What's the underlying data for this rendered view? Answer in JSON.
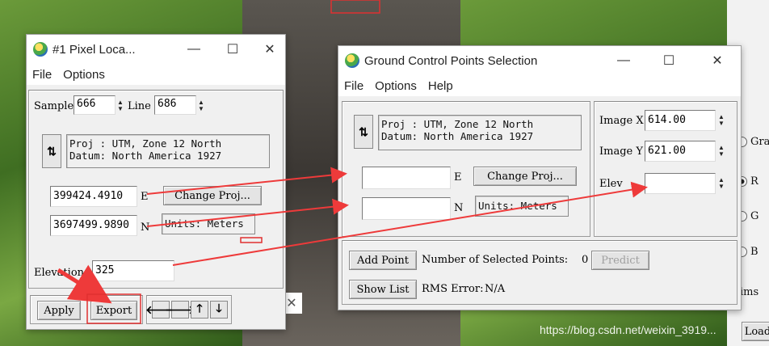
{
  "pixel_locator": {
    "title": "#1 Pixel Loca...",
    "menu": [
      "File",
      "Options"
    ],
    "sample_label": "Sample",
    "sample_value": "666",
    "line_label": "Line",
    "line_value": "686",
    "proj_readout": "Proj : UTM, Zone 12 North\nDatum: North America 1927",
    "easting_value": "399424.4910",
    "easting_label": "E",
    "northing_value": "3697499.9890",
    "northing_label": "N",
    "change_proj_label": "Change Proj...",
    "units_label": "Units: Meters",
    "elevation_label": "Elevation",
    "elevation_value": "325",
    "apply_label": "Apply",
    "export_label": "Export"
  },
  "gcp_window": {
    "title": "Ground Control Points Selection",
    "menu": [
      "File",
      "Options",
      "Help"
    ],
    "proj_readout": "Proj : UTM, Zone 12 North\nDatum: North America 1927",
    "easting_label": "E",
    "northing_label": "N",
    "easting_value": "",
    "northing_value": "",
    "change_proj_label": "Change Proj...",
    "units_label": "Units: Meters",
    "image_x_label": "Image X",
    "image_x_value": "614.00",
    "image_y_label": "Image Y",
    "image_y_value": "621.00",
    "elev_label": "Elev",
    "elev_value": "",
    "add_point_label": "Add Point",
    "selected_points_label": "Number of Selected Points:",
    "selected_points_value": "0",
    "predict_label": "Predict",
    "show_list_label": "Show List",
    "rms_label": "RMS Error:",
    "rms_value": "N/A"
  },
  "background_window": {
    "radio_labels": [
      "Gra",
      "R",
      "G",
      "B"
    ],
    "fragment_label": "ims",
    "button_fragment": "Load"
  },
  "watermark": "https://blog.csdn.net/weixin_3919..."
}
